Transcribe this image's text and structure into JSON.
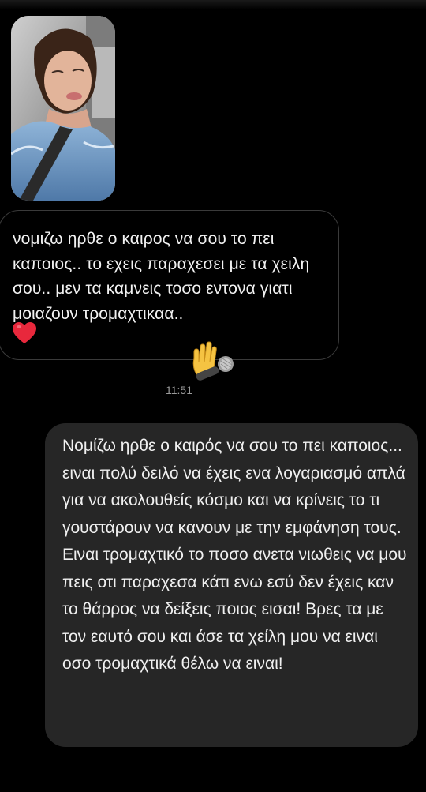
{
  "conversation": {
    "incoming_message": {
      "text": "νομιζω ηρθε ο καιρος να σου το πει καποιος.. το εχεις παραχεσει με τα χειλη σου.. μεν τα καμνεις τοσο εντονα γιατι μοιαζουν τρομαχτικαα..",
      "emoji": "heart-icon",
      "reaction": "raised-hand-with-microphone-icon"
    },
    "timestamp": "11:51",
    "outgoing_message": {
      "text": "Νομίζω ηρθε ο καιρός να σου το πει καποιος... ειναι πολύ δειλό να έχεις ενα λογαριασμό απλά για να ακολουθείς κόσμο και να κρίνεις το τι γουστάρουν να κανουν με την εμφάνηση τους. Ειναι τρομαχτικό το ποσο ανετα νιωθεις να μου πεις οτι παραχεσα κάτι ενω εσύ δεν έχεις καν το θάρρος να δείξεις ποιος εισαι! Βρες τα με τον εαυτό σου και άσε τα χείλη μου να ειναι οσο τρομαχτικά θέλω να ειναι!"
    },
    "colors": {
      "background": "#000000",
      "incoming_border": "#3a3a3a",
      "outgoing_bubble": "#262626",
      "timestamp": "#9a9a9a",
      "heart": "#e8283c"
    }
  }
}
